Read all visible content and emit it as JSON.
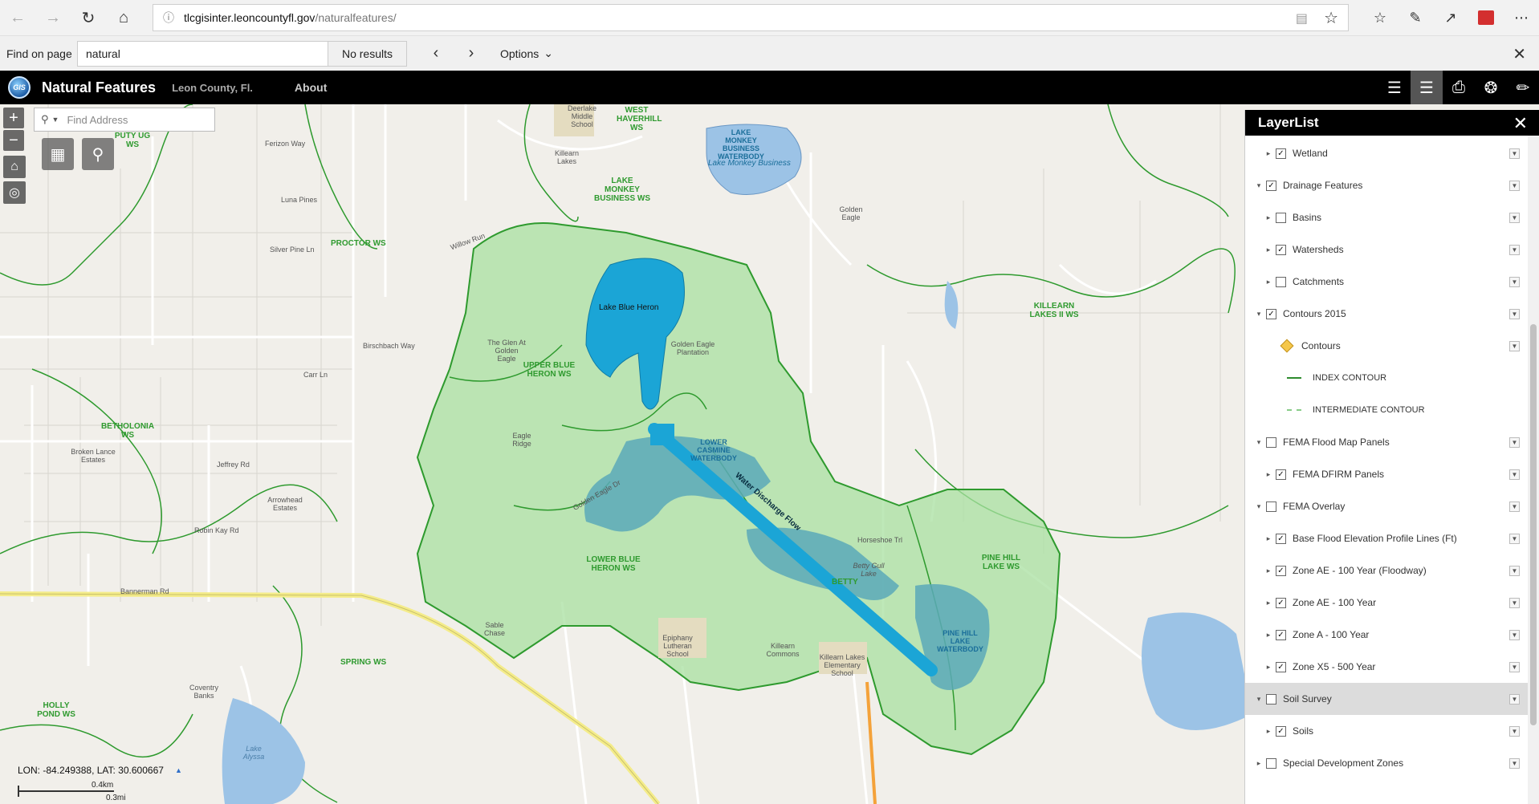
{
  "browser": {
    "url_host": "tlcgisinter.leoncountyfl.gov",
    "url_path": "/naturalfeatures/"
  },
  "find_bar": {
    "label": "Find on page",
    "query": "natural",
    "results": "No results",
    "options": "Options"
  },
  "header": {
    "logo_text": "GIS",
    "title": "Natural Features",
    "subtitle": "Leon County, Fl.",
    "about": "About"
  },
  "map": {
    "search_placeholder": "Find Address",
    "coords": "LON: -84.249388, LAT: 30.600667",
    "scale_km": "0.4km",
    "scale_mi": "0.3mi",
    "water_discharge_label": "Water Discharge Flow",
    "lake_blue_heron": "Lake Blue Heron",
    "lake_monkey_business": "Lake Monkey Business",
    "watersheds": {
      "west_haverhill": "WEST HAVERHILL WS",
      "putty": "PUTY UG WS",
      "lake_monkey": "LAKE MONKEY BUSINESS WS",
      "proctor": "PROCTOR WS",
      "killearn_lakes_ii": "KILLEARN LAKES II WS",
      "upper_blue_heron": "UPPER BLUE HERON WS",
      "betholonia": "BETHOLONIA WS",
      "lower_blue_heron": "LOWER BLUE HERON WS",
      "pine_hill_lake": "PINE HILL LAKE WS",
      "spring": "SPRING WS",
      "holly_pond": "HOLLY POND WS",
      "betty": "BETTY"
    },
    "waterbodies": {
      "lake_monkey_wb": "LAKE MONKEY BUSINESS WATERBODY",
      "lower_lakes": "LOWER CASMINE WATERBODY",
      "pine_hill_wb": "PINE HILL LAKE WATERBODY"
    },
    "places": {
      "deerlake_middle": "Deerlake Middle School",
      "killearn_lakes": "Killearn Lakes",
      "golden_eagle": "Golden Eagle",
      "golden_eagle_plantation": "Golden Eagle Plantation",
      "glen_golden_eagle": "The Glen At Golden Eagle",
      "eagle_ridge": "Eagle Ridge",
      "luna_pines": "Luna Pines",
      "broken_lance": "Broken Lance Estates",
      "arrowhead": "Arrowhead Estates",
      "sable_chase": "Sable Chase",
      "epiphany": "Epiphany Lutheran School",
      "killearn_commons": "Killearn Commons",
      "killearn_elementary": "Killearn Lakes Elementary School",
      "coventry_banks": "Coventry Banks",
      "lake_alyssa": "Lake Alyssa",
      "betty_gull_lake": "Betty Gull Lake"
    },
    "roads": {
      "bannerman": "Bannerman Rd",
      "ferizon": "Ferizon Way",
      "silver_pine": "Silver Pine Ln",
      "carr": "Carr Ln",
      "birschbach": "Birschbach Way",
      "jeffrey": "Jeffrey Rd",
      "robin_kay": "Robin Kay Rd",
      "golden_eagle_dr": "Golden Eagle Dr",
      "horseshoe": "Horseshoe Trl",
      "willow_run": "Willow Run"
    }
  },
  "layer_list": {
    "title": "LayerList",
    "rows": [
      {
        "label": "Wetland",
        "checked": "✓",
        "twisty": "▸",
        "indent": 1
      },
      {
        "label": "Drainage Features",
        "checked": "✓",
        "twisty": "▾",
        "indent": 0
      },
      {
        "label": "Basins",
        "checked": "",
        "twisty": "▸",
        "indent": 1
      },
      {
        "label": "Watersheds",
        "checked": "✓",
        "twisty": "▸",
        "indent": 1
      },
      {
        "label": "Catchments",
        "checked": "",
        "twisty": "▸",
        "indent": 1
      },
      {
        "label": "Contours 2015",
        "checked": "✓",
        "twisty": "▾",
        "indent": 0
      },
      {
        "label": "Contours",
        "checked": "",
        "twisty": "",
        "indent": 1
      },
      {
        "label": "INDEX CONTOUR",
        "checked": "",
        "twisty": "",
        "indent": 2
      },
      {
        "label": "INTERMEDIATE CONTOUR",
        "checked": "",
        "twisty": "",
        "indent": 2
      },
      {
        "label": "FEMA Flood Map Panels",
        "checked": "",
        "twisty": "▾",
        "indent": 0
      },
      {
        "label": "FEMA DFIRM Panels",
        "checked": "✓",
        "twisty": "▸",
        "indent": 1
      },
      {
        "label": "FEMA Overlay",
        "checked": "",
        "twisty": "▾",
        "indent": 0
      },
      {
        "label": "Base Flood Elevation Profile Lines (Ft)",
        "checked": "✓",
        "twisty": "▸",
        "indent": 1
      },
      {
        "label": "Zone AE - 100 Year (Floodway)",
        "checked": "✓",
        "twisty": "▸",
        "indent": 1
      },
      {
        "label": "Zone AE - 100 Year",
        "checked": "✓",
        "twisty": "▸",
        "indent": 1
      },
      {
        "label": "Zone A - 100 Year",
        "checked": "✓",
        "twisty": "▸",
        "indent": 1
      },
      {
        "label": "Zone X5 - 500 Year",
        "checked": "✓",
        "twisty": "▸",
        "indent": 1
      },
      {
        "label": "Soil Survey",
        "checked": "",
        "twisty": "▾",
        "indent": 0
      },
      {
        "label": "Soils",
        "checked": "✓",
        "twisty": "▸",
        "indent": 1
      },
      {
        "label": "Special Development Zones",
        "checked": "",
        "twisty": "▸",
        "indent": 0
      }
    ]
  }
}
